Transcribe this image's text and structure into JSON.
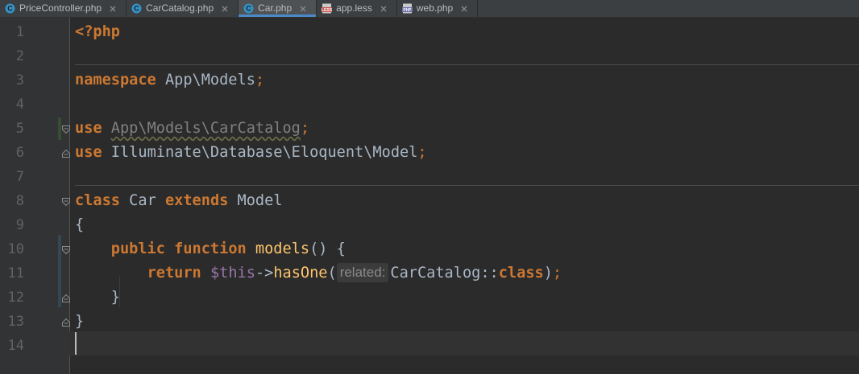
{
  "tabs": [
    {
      "label": "PriceController.php",
      "icon": "php-class-icon",
      "active": false
    },
    {
      "label": "CarCatalog.php",
      "icon": "php-class-icon",
      "active": false
    },
    {
      "label": "Car.php",
      "icon": "php-class-icon",
      "active": true
    },
    {
      "label": "app.less",
      "icon": "less-file-icon",
      "active": false
    },
    {
      "label": "web.php",
      "icon": "php-file-icon",
      "active": false
    }
  ],
  "line_numbers": [
    "1",
    "2",
    "3",
    "4",
    "5",
    "6",
    "7",
    "8",
    "9",
    "10",
    "11",
    "12",
    "13",
    "14"
  ],
  "code": {
    "l1": {
      "open_tag": "<?php"
    },
    "l3": {
      "kw": "namespace",
      "ns": " App\\Models",
      "semi": ";"
    },
    "l5": {
      "kw": "use",
      "name": "App\\Models\\CarCatalog",
      "semi": ";"
    },
    "l6": {
      "kw": "use",
      "name": " Illuminate\\Database\\Eloquent\\Model",
      "semi": ";"
    },
    "l8": {
      "kw1": "class",
      "name": " Car ",
      "kw2": "extends",
      "parent": " Model"
    },
    "l9": {
      "brace": "{"
    },
    "l10": {
      "indent": "    ",
      "kw1": "public",
      "sp": " ",
      "kw2": "function",
      "sp2": " ",
      "fn": "models",
      "rest": "() {"
    },
    "l11": {
      "indent": "        ",
      "kw": "return",
      "sp": " ",
      "var": "$this",
      "arrow": "->",
      "fn": "hasOne",
      "paren": "(",
      "hint": "related:",
      "cls": "CarCatalog::",
      "kw2": "class",
      "close": ")",
      "semi": ";"
    },
    "l12": {
      "indent": "    ",
      "brace": "}"
    },
    "l13": {
      "brace": "}"
    }
  },
  "colors": {
    "background": "#2b2b2b",
    "keyword": "#cc7832",
    "function": "#ffc66d",
    "variable": "#9876aa",
    "text": "#a9b7c6",
    "line_number": "#606366"
  }
}
